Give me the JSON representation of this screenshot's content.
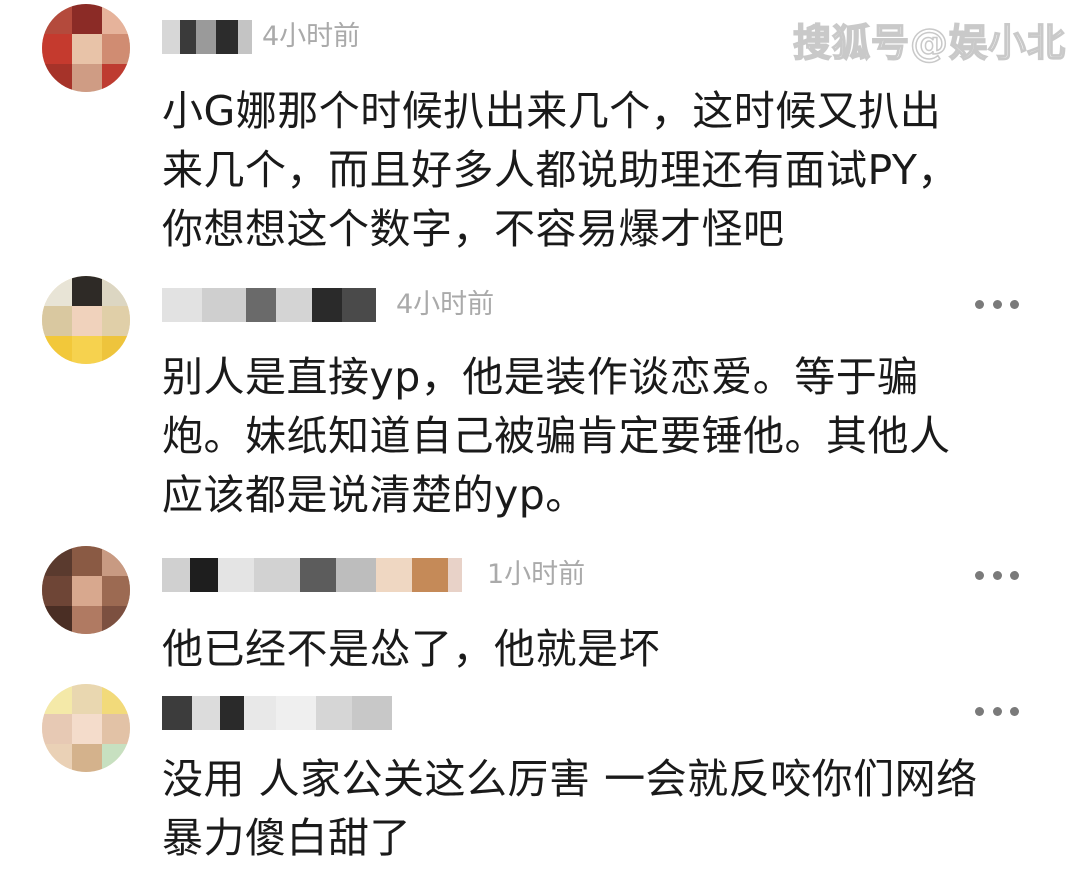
{
  "watermark": "搜狐号@娱小北",
  "comments": [
    {
      "time": "4小时前",
      "text": "小G娜那个时候扒出来几个，这时候又扒出\n来几个，而且好多人都说助理还有面试PY，\n你想想这个数字，不容易爆才怪吧",
      "has_more": false
    },
    {
      "time": "4小时前",
      "text": "别人是直接yp，他是装作谈恋爱。等于骗\n炮。妹纸知道自己被骗肯定要锤他。其他人\n应该都是说清楚的yp。",
      "has_more": true
    },
    {
      "time": "1小时前",
      "text": "他已经不是怂了，他就是坏",
      "has_more": true
    },
    {
      "time": "",
      "text": "没用 人家公关这么厉害 一会就反咬你们网络\n暴力傻白甜了",
      "has_more": true
    }
  ],
  "icons": {
    "more": "more-horizontal-icon"
  }
}
